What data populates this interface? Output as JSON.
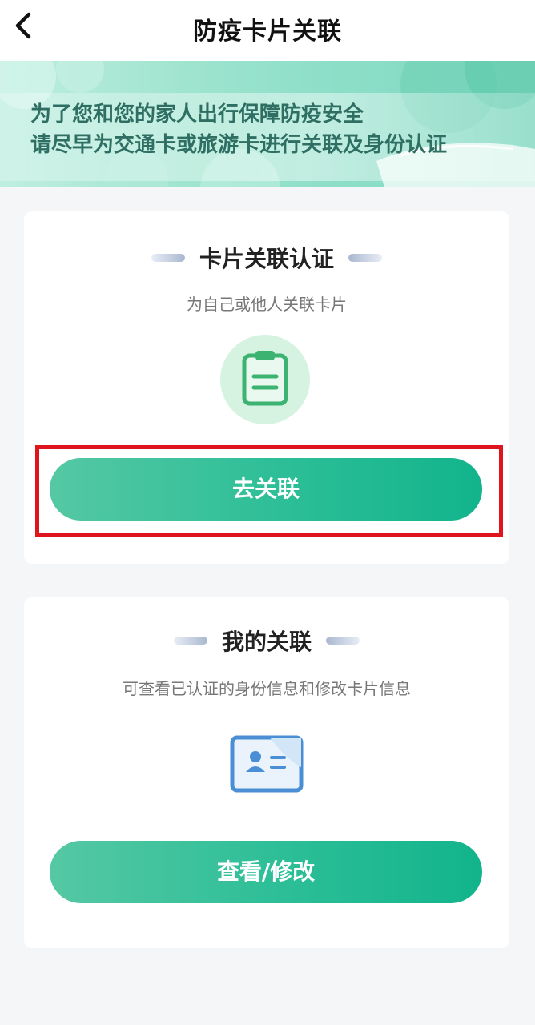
{
  "header": {
    "title": "防疫卡片关联",
    "back_icon": "chevron-left-icon"
  },
  "banner": {
    "line1": "为了您和您的家人出行保障防疫安全",
    "line2": "请尽早为交通卡或旅游卡进行关联及身份认证"
  },
  "card_link": {
    "title": "卡片关联认证",
    "subtitle": "为自己或他人关联卡片",
    "icon": "clipboard-icon",
    "button_label": "去关联"
  },
  "card_mine": {
    "title": "我的关联",
    "subtitle": "可查看已认证的身份信息和修改卡片信息",
    "icon": "id-card-icon",
    "button_label": "查看/修改"
  },
  "colors": {
    "accent": "#2fbf98",
    "highlight": "#e0141d",
    "icon_green": "#3cb371",
    "icon_blue": "#4a8fd6"
  }
}
